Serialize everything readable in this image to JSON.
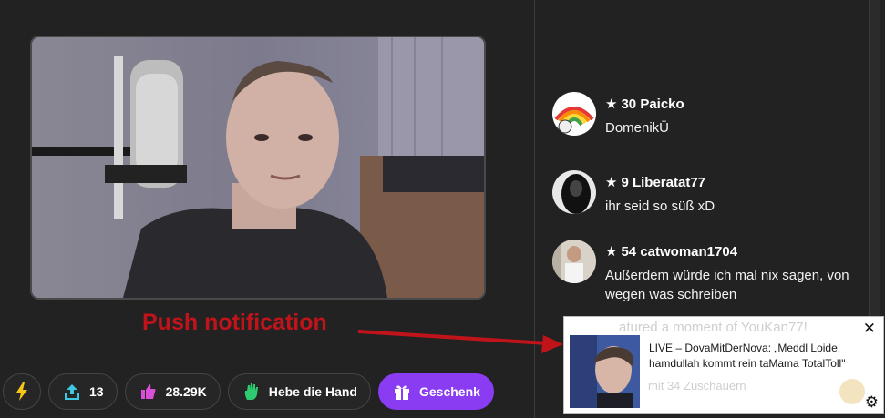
{
  "chat": {
    "messages": [
      {
        "star": "★",
        "rank": "30",
        "user": "Paicko",
        "text": "DomenikÜ",
        "avatar_icon": "rainbow-avatar"
      },
      {
        "star": "★",
        "rank": "9",
        "user": "Liberatat77",
        "text": "ihr seid so süß xD",
        "avatar_icon": "dark-avatar"
      },
      {
        "star": "★",
        "rank": "54",
        "user": "catwoman1704",
        "text": "Außerdem würde ich mal nix sagen, von wegen was schreiben",
        "avatar_icon": "photo-avatar"
      }
    ],
    "ghost_line": "atured a moment of YouKan77!",
    "ghost_line2": "mit 34 Zuschauern"
  },
  "annotation": {
    "label": "Push notification",
    "color": "#c0141a"
  },
  "toolbar": {
    "boost_icon": "lightning-icon",
    "share_count": "13",
    "likes_count": "28.29K",
    "raise_hand_label": "Hebe die Hand",
    "gift_label": "Geschenk",
    "gift_color": "#8a3cf2",
    "bolt_color": "#f5c518",
    "share_color": "#3cc8e0",
    "like_color": "#d84fd8",
    "hand_color": "#2ecc71"
  },
  "notification": {
    "close_glyph": "✕",
    "text": "LIVE – DovaMitDerNova: „Meddl Loide, hamdullah kommt rein taMama TotalToll\"",
    "settings_glyph": "⚙"
  }
}
